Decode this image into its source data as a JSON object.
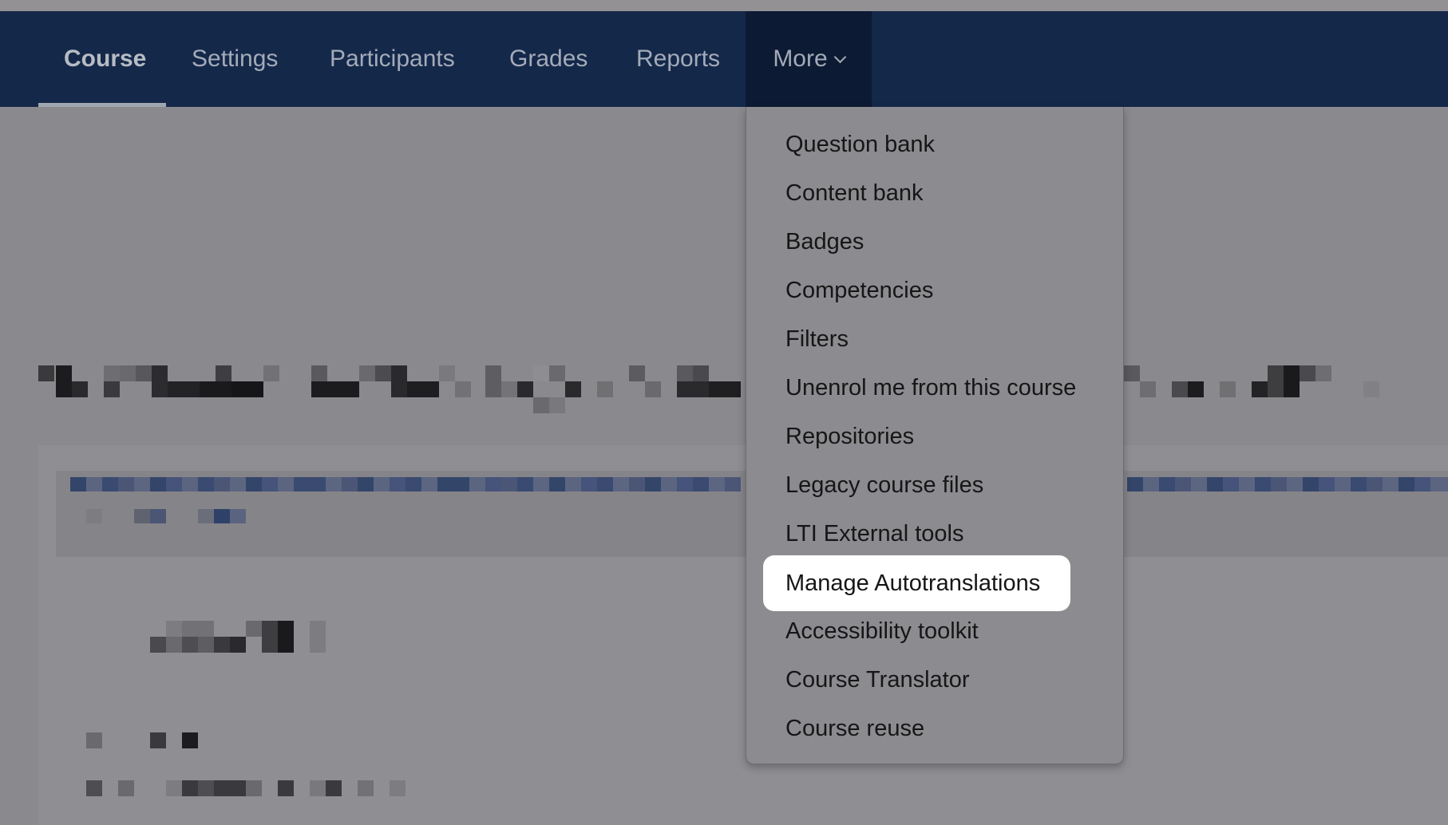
{
  "nav": {
    "items": [
      {
        "label": "Course",
        "name": "nav-course",
        "active": true
      },
      {
        "label": "Settings",
        "name": "nav-settings"
      },
      {
        "label": "Participants",
        "name": "nav-participants"
      },
      {
        "label": "Grades",
        "name": "nav-grades"
      },
      {
        "label": "Reports",
        "name": "nav-reports"
      }
    ],
    "more_label": "More",
    "more_icon": "chevron-down-icon"
  },
  "dropdown": {
    "items": [
      {
        "label": "Question bank"
      },
      {
        "label": "Content bank"
      },
      {
        "label": "Badges"
      },
      {
        "label": "Competencies"
      },
      {
        "label": "Filters"
      },
      {
        "label": "Unenrol me from this course"
      },
      {
        "label": "Repositories"
      },
      {
        "label": "Legacy course files"
      },
      {
        "label": "LTI External tools"
      },
      {
        "label": "Manage Autotranslations",
        "highlighted": true
      },
      {
        "label": "Accessibility toolkit"
      },
      {
        "label": "Course Translator"
      },
      {
        "label": "Course reuse"
      }
    ]
  },
  "colors": {
    "navbar": "#14284a",
    "more_active": "#0c1a33",
    "highlight": "#ffffff",
    "overlay": "#8a898d"
  }
}
